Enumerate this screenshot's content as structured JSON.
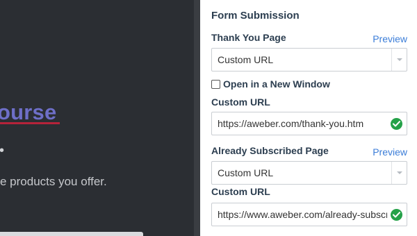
{
  "preview": {
    "headline": "ourse",
    "bullet": "•",
    "body_text": "e products you offer."
  },
  "panel": {
    "section_title": "Form Submission",
    "thank_you": {
      "label": "Thank You Page",
      "preview_link": "Preview",
      "select_value": "Custom URL",
      "checkbox_label": "Open in a New Window",
      "checkbox_checked": false,
      "url_label": "Custom URL",
      "url_value": "https://aweber.com/thank-you.htm"
    },
    "already_subscribed": {
      "label": "Already Subscribed Page",
      "preview_link": "Preview",
      "select_value": "Custom URL",
      "url_label": "Custom URL",
      "url_value": "https://www.aweber.com/already-subscr"
    }
  },
  "colors": {
    "accent_link": "#3b7dd8",
    "valid_check": "#24a148",
    "preview_bg": "#2b2e33",
    "headline": "#6e6fc8"
  },
  "icons": {
    "select_arrow": "chevron-down-icon",
    "valid": "check-circle-icon"
  }
}
